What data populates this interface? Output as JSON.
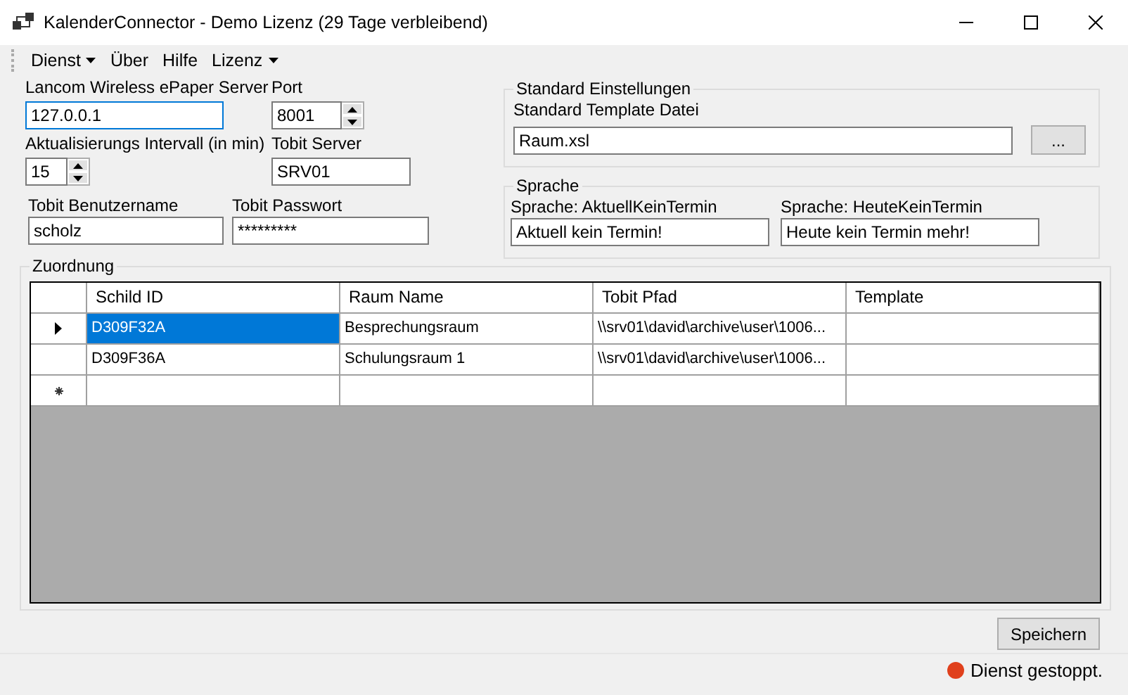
{
  "window": {
    "title": "KalenderConnector - Demo Lizenz (29 Tage verbleibend)"
  },
  "menu": [
    {
      "label": "Dienst",
      "dropdown": true
    },
    {
      "label": "Über",
      "dropdown": false
    },
    {
      "label": "Hilfe",
      "dropdown": false
    },
    {
      "label": "Lizenz",
      "dropdown": true
    }
  ],
  "settings": {
    "server": {
      "label": "Lancom Wireless ePaper Server",
      "value": "127.0.0.1",
      "focused": true
    },
    "port": {
      "label": "Port",
      "value": "8001"
    },
    "interval": {
      "label": "Aktualisierungs Intervall (in min)",
      "value": "15"
    },
    "tobit_server": {
      "label": "Tobit Server",
      "value": "SRV01"
    },
    "user": {
      "label": "Tobit Benutzername",
      "value": "scholz"
    },
    "password": {
      "label": "Tobit Passwort",
      "value": "*********"
    }
  },
  "standard": {
    "title": "Standard Einstellungen",
    "label": "Standard Template Datei",
    "value": "Raum.xsl",
    "browse": "..."
  },
  "sprache": {
    "title": "Sprache",
    "fields": [
      {
        "label": "Sprache: AktuellKeinTermin",
        "value": "Aktuell kein Termin!"
      },
      {
        "label": "Sprache: HeuteKeinTermin",
        "value": "Heute kein Termin mehr!"
      }
    ]
  },
  "zuordnung": {
    "title": "Zuordnung",
    "columns": [
      "Schild ID",
      "Raum Name",
      "Tobit Pfad",
      "Template"
    ],
    "rows": [
      {
        "current": true,
        "cells": [
          {
            "text": "D309F32A",
            "selected": true
          },
          {
            "text": "Besprechungsraum",
            "selected": false
          },
          {
            "text": "\\\\srv01\\david\\archive\\user\\1006...",
            "selected": false
          }
        ]
      },
      {
        "current": false,
        "cells": [
          {
            "text": "D309F36A",
            "selected": false
          },
          {
            "text": "Schulungsraum 1",
            "selected": false
          },
          {
            "text": "\\\\srv01\\david\\archive\\user\\1006...",
            "selected": false
          }
        ]
      }
    ],
    "new_row": true
  },
  "save_button": "Speichern",
  "status_bar": {
    "text": "Dienst gestoppt.",
    "running": false
  }
}
